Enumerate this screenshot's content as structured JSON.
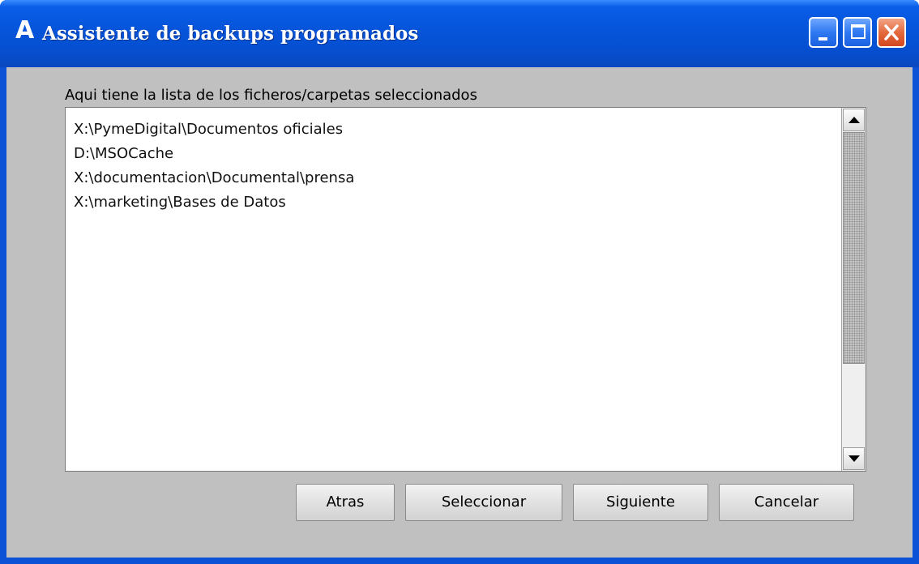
{
  "window": {
    "app_logo_letter": "A",
    "title": "Assistente de backups programados",
    "controls": {
      "minimize_icon": "minimize-icon",
      "maximize_icon": "maximize-icon",
      "close_icon": "close-icon"
    },
    "colors": {
      "titlebar": "#0654d9",
      "client_bg": "#c0c0c0",
      "close_button": "#e46a3e"
    }
  },
  "list": {
    "caption": "Aqui tiene la lista de los ficheros/carpetas seleccionados",
    "items": [
      "X:\\PymeDigital\\Documentos oficiales",
      "D:\\MSOCache",
      "X:\\documentacion\\Documental\\prensa",
      "X:\\marketing\\Bases de Datos"
    ]
  },
  "buttons": {
    "back": "Atras",
    "select": "Seleccionar",
    "next": "Siguiente",
    "cancel": "Cancelar"
  }
}
